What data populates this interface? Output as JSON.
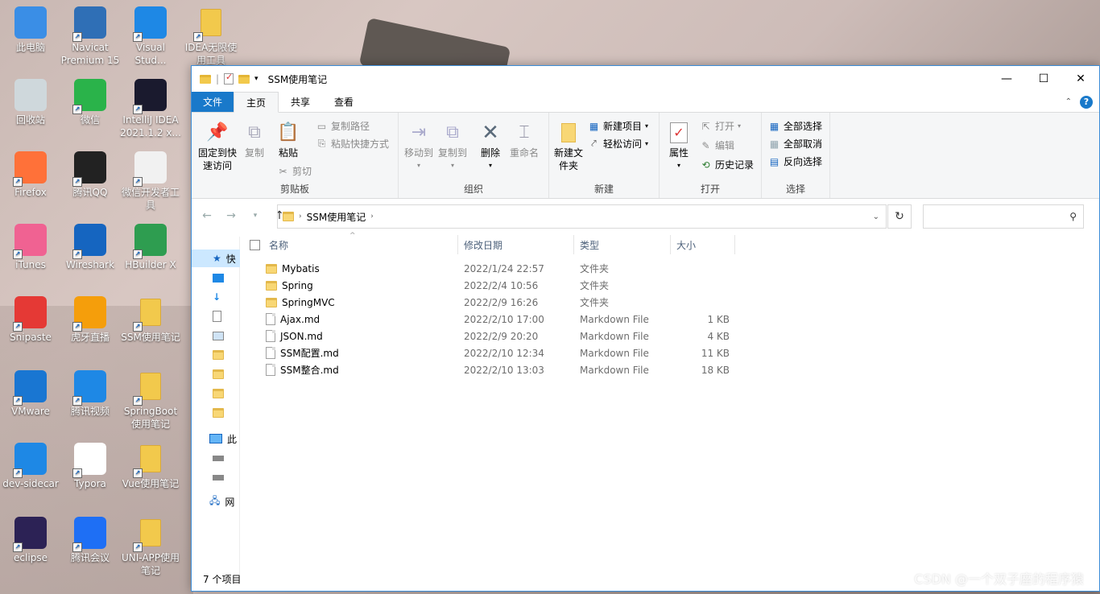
{
  "desktop": {
    "icons": [
      {
        "label": "此电脑",
        "icon": "computer-icon",
        "color": "#3a8ee6"
      },
      {
        "label": "Navicat Premium 15",
        "icon": "navicat-icon",
        "color": "#2f6fb6"
      },
      {
        "label": "Visual Stud...",
        "icon": "vscode-icon",
        "color": "#1e88e5"
      },
      {
        "label": "IDEA无限使用工具",
        "icon": "folder-icon",
        "color": "#f2c94c"
      },
      {
        "label": "回收站",
        "icon": "recycle-bin-icon",
        "color": "#cfd8dc"
      },
      {
        "label": "微信",
        "icon": "wechat-icon",
        "color": "#2ab34a"
      },
      {
        "label": "IntelliJ IDEA 2021.1.2 x...",
        "icon": "intellij-icon",
        "color": "#1a1a2e"
      },
      {
        "label": "Firefox",
        "icon": "firefox-icon",
        "color": "#ff7139"
      },
      {
        "label": "腾讯QQ",
        "icon": "qq-icon",
        "color": "#222222"
      },
      {
        "label": "微信开发者工具",
        "icon": "wechat-devtools-icon",
        "color": "#f1f1f1"
      },
      {
        "label": "iTunes",
        "icon": "itunes-icon",
        "color": "#f06292"
      },
      {
        "label": "Wireshark",
        "icon": "wireshark-icon",
        "color": "#1565c0"
      },
      {
        "label": "HBuilder X",
        "icon": "hbuilder-icon",
        "color": "#2e9d50"
      },
      {
        "label": "Snipaste",
        "icon": "snipaste-icon",
        "color": "#e53935"
      },
      {
        "label": "虎牙直播",
        "icon": "huya-icon",
        "color": "#f59e0b"
      },
      {
        "label": "SSM使用笔记",
        "icon": "folder-icon",
        "color": "#f2c94c"
      },
      {
        "label": "VMware",
        "icon": "vmware-icon",
        "color": "#1976d2"
      },
      {
        "label": "腾讯视频",
        "icon": "tencent-video-icon",
        "color": "#1e88e5"
      },
      {
        "label": "SpringBoot使用笔记",
        "icon": "folder-icon",
        "color": "#f2c94c"
      },
      {
        "label": "dev-sidecar",
        "icon": "dev-sidecar-icon",
        "color": "#1e88e5"
      },
      {
        "label": "Typora",
        "icon": "typora-icon",
        "color": "#ffffff"
      },
      {
        "label": "Vue使用笔记",
        "icon": "folder-icon",
        "color": "#f2c94c"
      },
      {
        "label": "eclipse",
        "icon": "eclipse-icon",
        "color": "#2c2255"
      },
      {
        "label": "腾讯会议",
        "icon": "tencent-meeting-icon",
        "color": "#1e6ff5"
      },
      {
        "label": "UNI-APP使用笔记",
        "icon": "folder-icon",
        "color": "#f2c94c"
      }
    ]
  },
  "window": {
    "title": "SSM使用笔记",
    "controls": {
      "minimize": "—",
      "maximize": "☐",
      "close": "✕"
    }
  },
  "tabs": {
    "file": "文件",
    "home": "主页",
    "share": "共享",
    "view": "查看"
  },
  "ribbon": {
    "clipboard": {
      "pin": "固定到快速访问",
      "copy": "复制",
      "paste": "粘贴",
      "copy_path": "复制路径",
      "paste_shortcut": "粘贴快捷方式",
      "cut": "剪切",
      "label": "剪贴板"
    },
    "organize": {
      "move_to": "移动到",
      "copy_to": "复制到",
      "delete": "删除",
      "rename": "重命名",
      "label": "组织"
    },
    "new": {
      "new_folder": "新建文件夹",
      "new_item": "新建项目",
      "easy_access": "轻松访问",
      "label": "新建"
    },
    "open": {
      "properties": "属性",
      "open": "打开",
      "edit": "编辑",
      "history": "历史记录",
      "label": "打开"
    },
    "select": {
      "select_all": "全部选择",
      "select_none": "全部取消",
      "invert": "反向选择",
      "label": "选择"
    }
  },
  "address": {
    "path": "SSM使用笔记",
    "search_placeholder": ""
  },
  "nav": {
    "quick_access": "快",
    "this_pc": "此",
    "network": "网"
  },
  "columns": {
    "name": "名称",
    "date": "修改日期",
    "type": "类型",
    "size": "大小"
  },
  "files": [
    {
      "name": "Mybatis",
      "date": "2022/1/24 22:57",
      "type": "文件夹",
      "size": "",
      "kind": "folder"
    },
    {
      "name": "Spring",
      "date": "2022/2/4 10:56",
      "type": "文件夹",
      "size": "",
      "kind": "folder"
    },
    {
      "name": "SpringMVC",
      "date": "2022/2/9 16:26",
      "type": "文件夹",
      "size": "",
      "kind": "folder"
    },
    {
      "name": "Ajax.md",
      "date": "2022/2/10 17:00",
      "type": "Markdown File",
      "size": "1 KB",
      "kind": "md"
    },
    {
      "name": "JSON.md",
      "date": "2022/2/9 20:20",
      "type": "Markdown File",
      "size": "4 KB",
      "kind": "md"
    },
    {
      "name": "SSM配置.md",
      "date": "2022/2/10 12:34",
      "type": "Markdown File",
      "size": "11 KB",
      "kind": "md"
    },
    {
      "name": "SSM整合.md",
      "date": "2022/2/10 13:03",
      "type": "Markdown File",
      "size": "18 KB",
      "kind": "md"
    }
  ],
  "status": "7 个项目",
  "watermark": "CSDN @一个双子座的程序猿"
}
